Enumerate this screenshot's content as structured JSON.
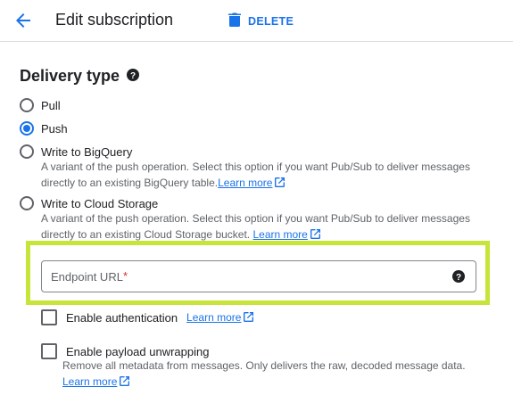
{
  "header": {
    "title": "Edit subscription",
    "delete_label": "DELETE"
  },
  "delivery": {
    "title": "Delivery type",
    "options": [
      {
        "label": "Pull",
        "checked": false
      },
      {
        "label": "Push",
        "checked": true
      },
      {
        "label": "Write to BigQuery",
        "checked": false,
        "description": "A variant of the push operation. Select this option if you want Pub/Sub to deliver messages directly to an existing BigQuery table.",
        "link": "Learn more"
      },
      {
        "label": "Write to Cloud Storage",
        "checked": false,
        "description": "A variant of the push operation. Select this option if you want Pub/Sub to deliver messages directly to an existing Cloud Storage bucket.",
        "link": "Learn more"
      }
    ]
  },
  "push": {
    "endpoint_placeholder": "Endpoint URL",
    "endpoint_value": "",
    "required_mark": "*",
    "auth_label": "Enable authentication",
    "auth_link": "Learn more",
    "unwrap_label": "Enable payload unwrapping",
    "unwrap_description": "Remove all metadata from messages. Only delivers the raw, decoded message data.",
    "unwrap_link": "Learn more"
  },
  "colors": {
    "accent": "#1a73e8",
    "highlight": "#c6e43a",
    "required": "#d93025"
  },
  "icons": {
    "back": "arrow-left-icon",
    "delete": "trash-icon",
    "help": "help-circle-icon",
    "external": "external-link-icon"
  }
}
